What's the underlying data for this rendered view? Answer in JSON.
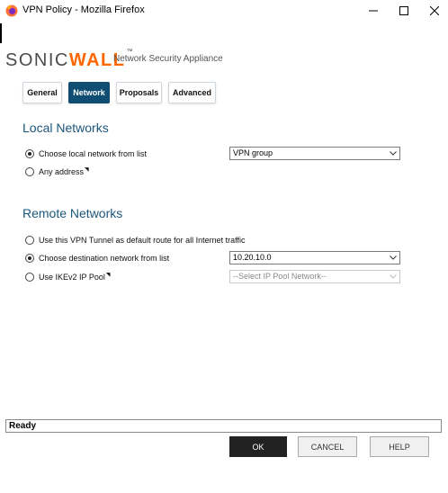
{
  "window": {
    "title": "VPN Policy - Mozilla Firefox"
  },
  "brand": {
    "logo_prefix": "SONIC",
    "logo_suffix": "WALL",
    "trademark": "™",
    "tagline": "Network Security Appliance",
    "accent_color": "#ff6600"
  },
  "tabs": [
    {
      "label": "General",
      "active": false
    },
    {
      "label": "Network",
      "active": true
    },
    {
      "label": "Proposals",
      "active": false
    },
    {
      "label": "Advanced",
      "active": false
    }
  ],
  "local_networks": {
    "title": "Local Networks",
    "choose_from_list": {
      "label": "Choose local network from list",
      "checked": true
    },
    "any_address": {
      "label": "Any address",
      "checked": false
    },
    "network_select": {
      "value": "VPN group"
    }
  },
  "remote_networks": {
    "title": "Remote Networks",
    "default_route": {
      "label": "Use this VPN Tunnel as default route for all Internet traffic",
      "checked": false
    },
    "choose_destination": {
      "label": "Choose destination network from list",
      "checked": true
    },
    "destination_select": {
      "value": "10.20.10.0"
    },
    "ikev2_pool": {
      "label": "Use IKEv2 IP Pool",
      "checked": false
    },
    "pool_select": {
      "value": "--Select IP Pool Network--",
      "disabled": true
    }
  },
  "status": {
    "text": "Ready"
  },
  "buttons": {
    "ok": "OK",
    "cancel": "CANCEL",
    "help": "HELP"
  },
  "colors": {
    "tab_active": "#0f4d72",
    "section_title": "#1b567c",
    "ok_button": "#222222"
  }
}
